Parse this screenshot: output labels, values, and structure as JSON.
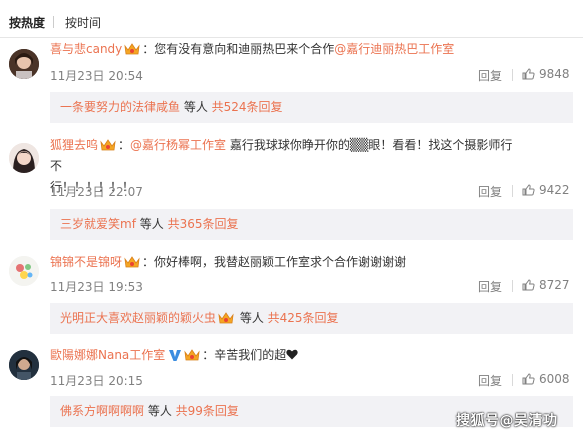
{
  "sort": {
    "hot": "按热度",
    "time": "按时间"
  },
  "comments": [
    {
      "user": "喜与悲candy",
      "prefix": "：您有没有意向和迪丽热巴来个合作",
      "mention": "@嘉行迪丽热巴工作室",
      "suffix": "",
      "date": "11月23日 20:54",
      "reply": "回复",
      "likes": "9848",
      "sub_user": "一条要努力的法律咸鱼",
      "sub_mid": " 等人 ",
      "sub_count": "共524条回复"
    },
    {
      "user": "狐狸去呜",
      "prefix": "：",
      "mention": "@嘉行杨幂工作室",
      "suffix": " 嘉行我球球你睁开你的▒▒眼！看看！找这个摄影师行不",
      "suffix2": "行！！！！！！",
      "date": "11月23日 22:07",
      "reply": "回复",
      "likes": "9422",
      "sub_user": "三岁就爱笑mf",
      "sub_mid": " 等人 ",
      "sub_count": "共365条回复"
    },
    {
      "user": "锦锦不是锦呀",
      "prefix": "：你好棒啊，我替赵丽颖工作室求个合作谢谢谢谢",
      "mention": "",
      "suffix": "",
      "date": "11月23日 19:53",
      "reply": "回复",
      "likes": "8727",
      "sub_user": "光明正大喜欢赵丽颖的颖火虫",
      "sub_mid": " 等人 ",
      "sub_count": "共425条回复"
    },
    {
      "user": "歐陽娜娜Nana工作室",
      "prefix": "：辛苦我们的超",
      "mention": "",
      "suffix": "",
      "date": "11月23日 20:15",
      "reply": "回复",
      "likes": "6008",
      "sub_user": "佛系方啊啊啊啊",
      "sub_mid": " 等人 ",
      "sub_count": "共99条回复"
    }
  ],
  "watermark": "搜狐号@吴清功",
  "colors": {
    "accent": "#eb7350",
    "meta": "#808080",
    "subbg": "#f2f2f5"
  }
}
